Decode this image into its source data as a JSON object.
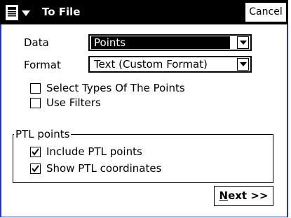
{
  "titlebar": {
    "title": "To File",
    "cancel_label": "Cancel",
    "start_icon": "start-menu-icon"
  },
  "form": {
    "data_label": "Data",
    "data_value": "Points",
    "format_label": "Format",
    "format_value": "Text (Custom Format)"
  },
  "options": {
    "select_types": {
      "label": "Select Types Of The Points",
      "checked": false
    },
    "use_filters": {
      "label": "Use Filters",
      "checked": false
    }
  },
  "ptl_group": {
    "title": "PTL points",
    "include_ptl": {
      "label": "Include PTL points",
      "checked": true
    },
    "show_ptl_coords": {
      "label": "Show PTL coordinates",
      "checked": true
    }
  },
  "next_button": {
    "mnemonic": "N",
    "rest": "ext >>"
  },
  "colors": {
    "titlebar_bg": "#000000",
    "frame_border": "#1f3aa8",
    "background": "#ffffff"
  }
}
